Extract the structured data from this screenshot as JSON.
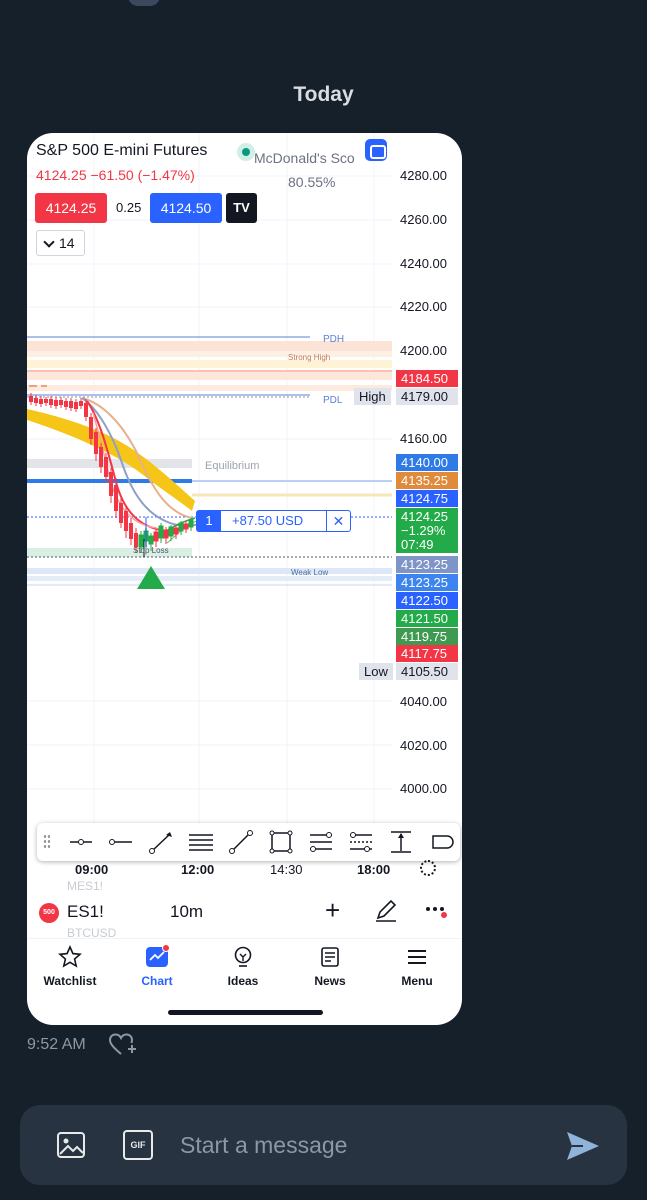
{
  "conversation": {
    "day_label": "Today",
    "message_time": "9:52 AM",
    "composer_placeholder": "Start a message"
  },
  "chart_app": {
    "symbol_title": "S&P 500 E-mini Futures",
    "change_line": "4124.25  −61.50 (−1.47%)",
    "indicator_name": "McDonald's Sco",
    "indicator_value": "80.55%",
    "sell_price": "4124.25",
    "spread": "0.25",
    "buy_price": "4124.50",
    "logo_text": "TV",
    "interval_count": "14",
    "levels": {
      "pdh": "PDH",
      "strong_high": "Strong High",
      "pdl": "PDL",
      "equilibrium": "Equilibrium",
      "stop_loss": "Stop Loss",
      "weak_low": "Weak Low",
      "high": "High",
      "low": "Low"
    },
    "position": {
      "qty": "1",
      "pnl": "+87.50 USD",
      "close": "✕"
    },
    "price_axis": [
      "4280.00",
      "4260.00",
      "4240.00",
      "4220.00",
      "4200.00",
      "4160.00",
      "4040.00",
      "4020.00",
      "4000.00"
    ],
    "price_tags": {
      "t4184": "4184.50",
      "t4179": "4179.00",
      "t4140": "4140.00",
      "t4135": "4135.25",
      "t4124_75": "4124.75",
      "cur_price": "4124.25",
      "cur_change": "−1.29%",
      "cur_timer": "07:49",
      "t4123a": "4123.25",
      "t4123b": "4123.25",
      "t4122": "4122.50",
      "t4121": "4121.50",
      "t4119": "4119.75",
      "t4117": "4117.75",
      "t4105": "4105.50"
    },
    "time_axis": [
      "09:00",
      "12:00",
      "14:30",
      "18:00"
    ],
    "watch_ghost_top": "MES1!",
    "watch_ghost_bottom": "BTCUSD",
    "symbol_badge": "500",
    "symbol": "ES1!",
    "interval": "10m",
    "nav": [
      "Watchlist",
      "Chart",
      "Ideas",
      "News",
      "Menu"
    ],
    "colors": {
      "red": "#f23645",
      "blue": "#2962ff",
      "green": "#22ab48",
      "orange": "#e08a3c",
      "yellow": "#f5c518"
    }
  }
}
